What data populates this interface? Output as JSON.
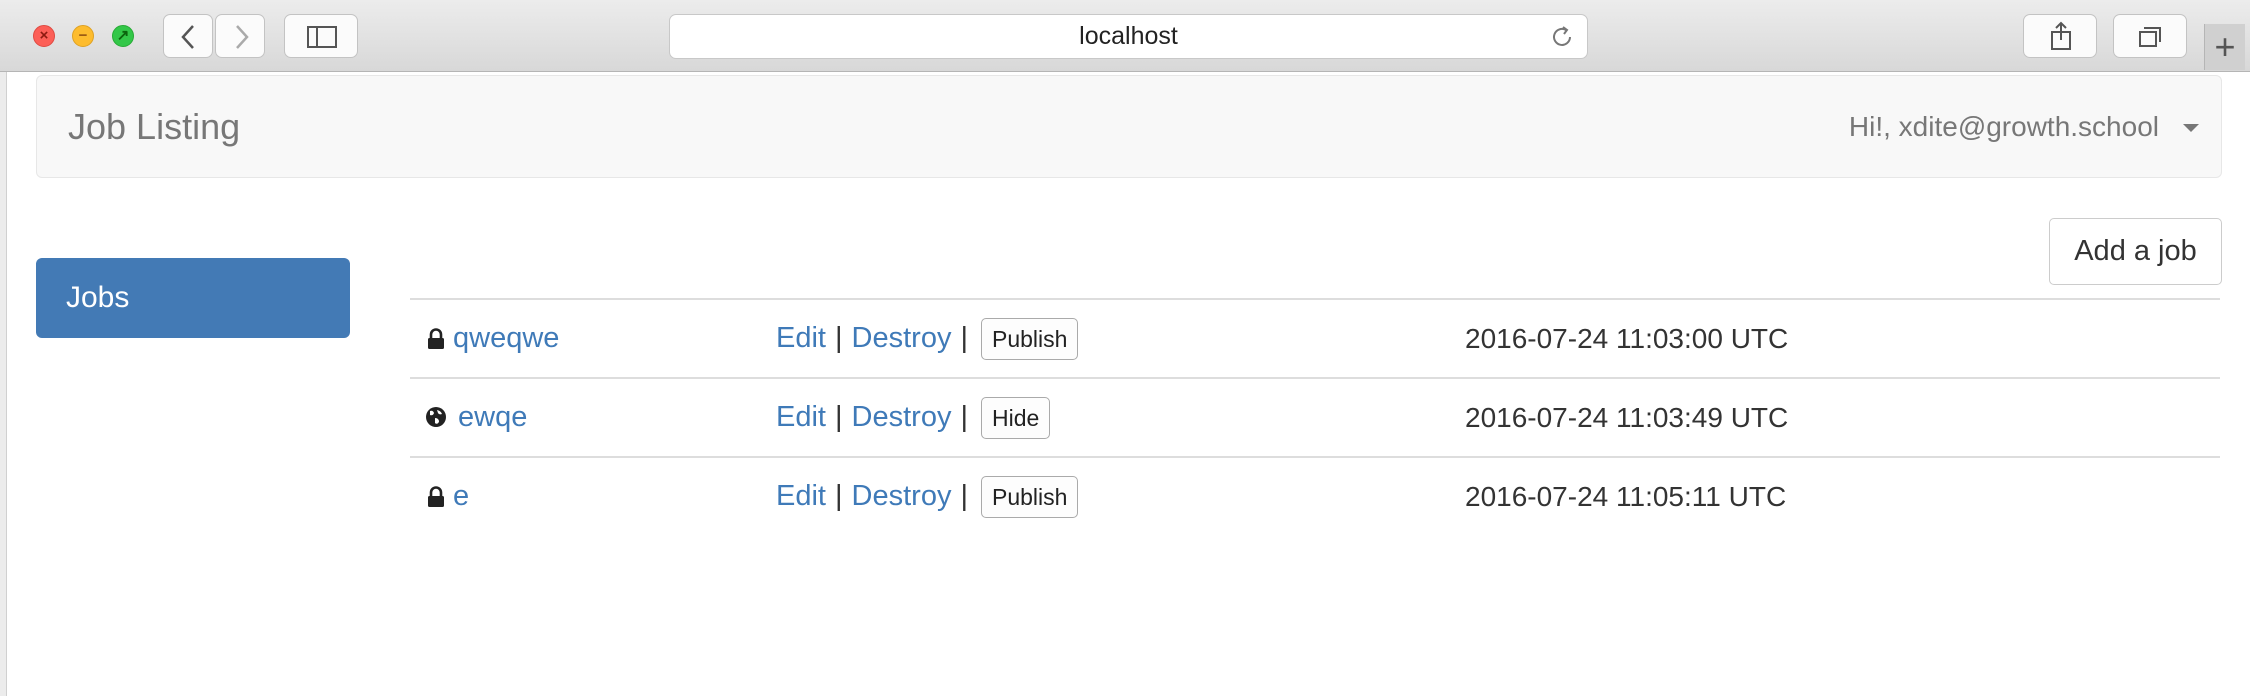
{
  "browser": {
    "url": "localhost",
    "new_tab_label": "+"
  },
  "navbar": {
    "brand": "Job Listing",
    "user_menu": "Hi!, xdite@growth.school"
  },
  "sidebar": {
    "items": [
      {
        "label": "Jobs",
        "active": true
      }
    ]
  },
  "jobs": {
    "add_label": "Add a job",
    "rows": [
      {
        "title": "qweqwe",
        "visibility_icon": "lock-icon",
        "edit": "Edit",
        "destroy": "Destroy",
        "toggle": "Publish",
        "date": "2016-07-24 11:03:00 UTC"
      },
      {
        "title": "ewqe",
        "visibility_icon": "globe-icon",
        "edit": "Edit",
        "destroy": "Destroy",
        "toggle": "Hide",
        "date": "2016-07-24 11:03:49 UTC"
      },
      {
        "title": "e",
        "visibility_icon": "lock-icon",
        "edit": "Edit",
        "destroy": "Destroy",
        "toggle": "Publish",
        "date": "2016-07-24 11:05:11 UTC"
      }
    ],
    "separator": "|"
  },
  "colors": {
    "link": "#3f7ab8",
    "sidebar_active": "#437ab5",
    "navbar_bg": "#f8f8f8"
  }
}
